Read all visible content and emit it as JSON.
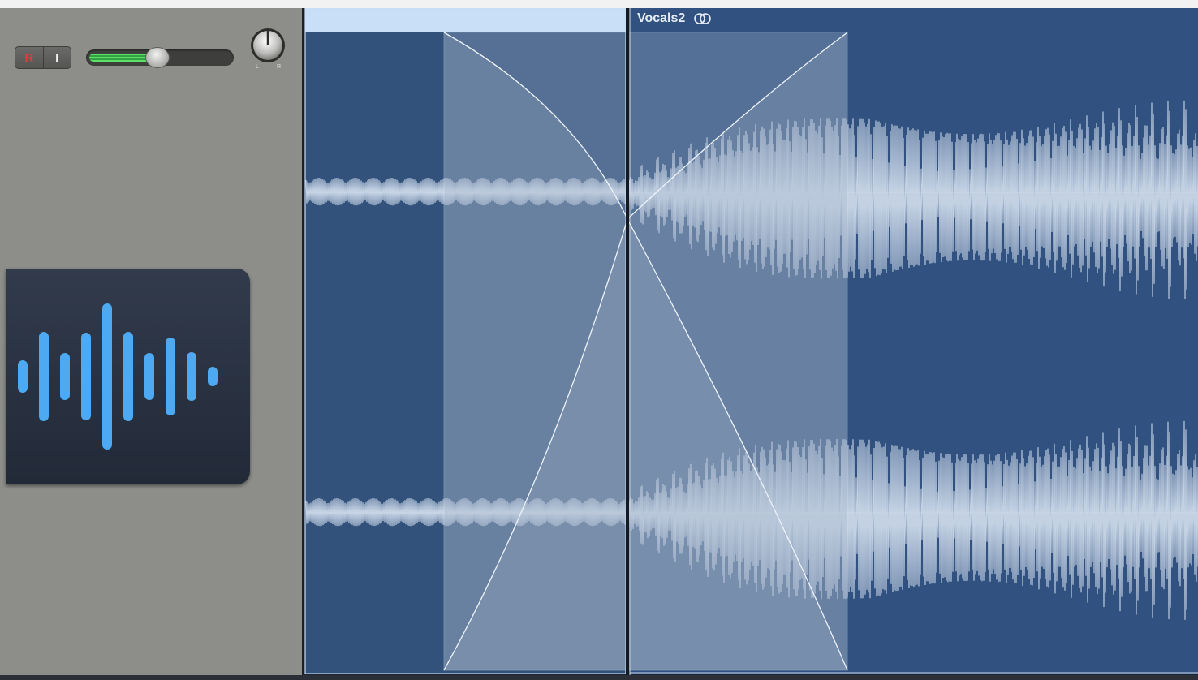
{
  "track": {
    "record_label": "R",
    "input_monitor_label": "I",
    "volume_level": 0.48,
    "pan_knob_left_label": "L",
    "pan_knob_right_label": "R",
    "icon": "waveform-icon"
  },
  "regions": [
    {
      "name": ""
    },
    {
      "name": "Vocals2",
      "loop_icon": "linked-circles-icon"
    }
  ],
  "colors": {
    "region_left": "#32527c",
    "region_right": "#315280",
    "region_header_selected": "#c8dff7",
    "crossfade_fill": "#b0bfd2",
    "waveform": "#cfdcec",
    "volume_green": "#5de06a",
    "record_red": "#e23b3b",
    "icon_blue": "#4daaf2"
  }
}
